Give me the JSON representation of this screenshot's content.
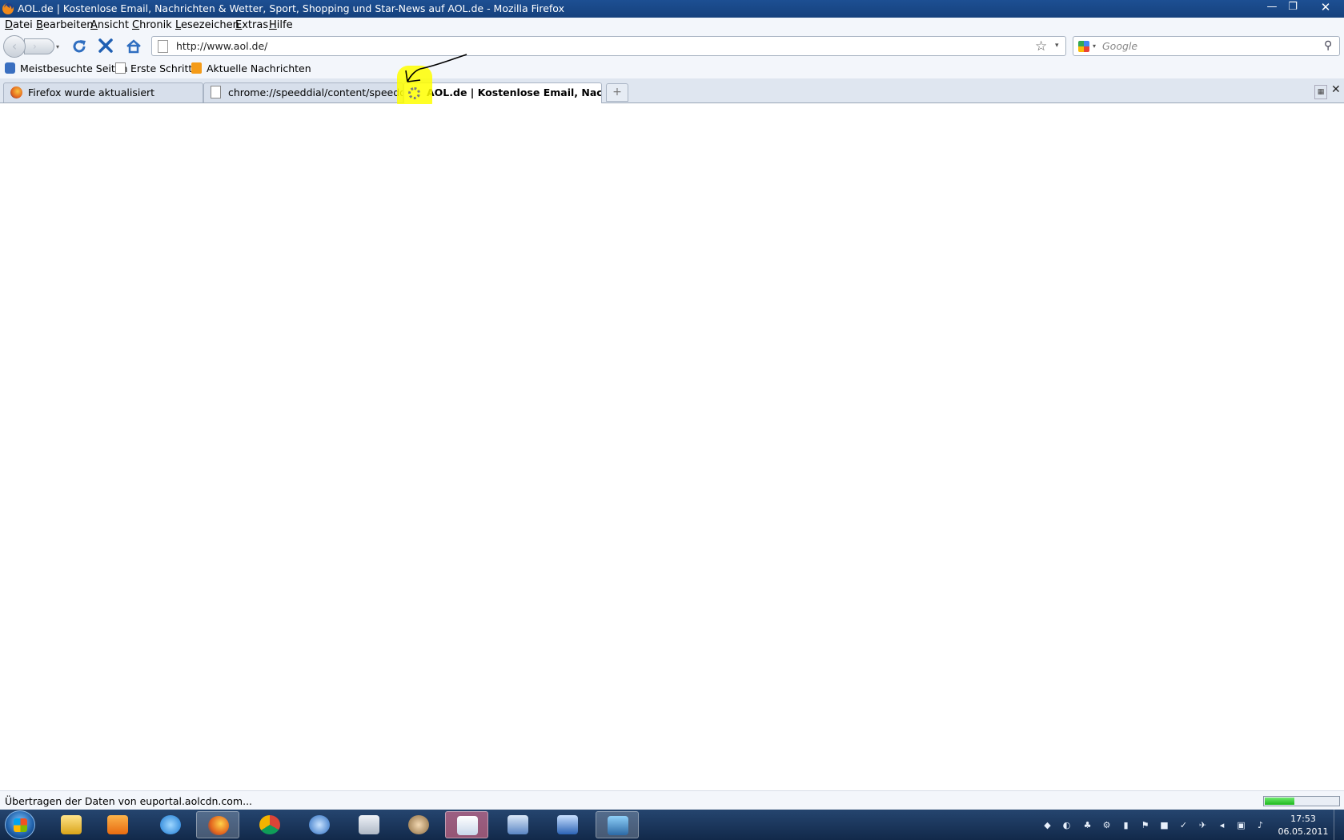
{
  "window": {
    "title": "AOL.de | Kostenlose Email, Nachrichten & Wetter, Sport, Shopping und Star-News auf AOL.de - Mozilla Firefox",
    "minimize_label": "—",
    "maximize_label": "❐",
    "close_label": "✕"
  },
  "menu": {
    "items": [
      {
        "mnemonic": "D",
        "rest": "atei"
      },
      {
        "mnemonic": "B",
        "rest": "earbeiten"
      },
      {
        "mnemonic": "A",
        "rest": "nsicht"
      },
      {
        "mnemonic": "C",
        "rest": "hronik"
      },
      {
        "mnemonic": "L",
        "rest": "esezeichen"
      },
      {
        "mnemonic": "E",
        "rest": "xtras"
      },
      {
        "mnemonic": "H",
        "rest": "ilfe"
      }
    ]
  },
  "nav": {
    "back_glyph": "‹",
    "forward_glyph": "›",
    "history_glyph": "▾",
    "url": "http://www.aol.de/",
    "star_glyph": "☆",
    "dropdown_glyph": "▾"
  },
  "search": {
    "placeholder": "Google",
    "engine_dropdown_glyph": "▾",
    "go_glyph": "⚲"
  },
  "bookmarks": {
    "items": [
      {
        "label": "Meistbesuchte Seiten",
        "icon": "most-visited-icon"
      },
      {
        "label": "Erste Schritte",
        "icon": "page-icon"
      },
      {
        "label": "Aktuelle Nachrichten",
        "icon": "rss-feed-icon"
      }
    ]
  },
  "tabs": {
    "items": [
      {
        "label": "Firefox wurde aktualisiert",
        "icon": "firefox-icon",
        "active": false
      },
      {
        "label": "chrome://speeddial/content/speeddial....",
        "icon": "page-icon",
        "active": false
      },
      {
        "label": "AOL.de | Kostenlose Email, Nachricht...",
        "icon": "loading-spinner-icon",
        "active": true
      }
    ],
    "new_tab_glyph": "+",
    "list_all_glyph": "▦",
    "close_glyph": "✕"
  },
  "status": {
    "text": "Übertragen der Daten von euportal.aolcdn.com...",
    "progress": 0.4
  },
  "taskbar": {
    "apps": [
      {
        "name": "windows-explorer",
        "icon": "folder-icon"
      },
      {
        "name": "media-player",
        "icon": "media-player-icon"
      },
      {
        "name": "internet-explorer",
        "icon": "ie-icon"
      },
      {
        "name": "firefox",
        "icon": "firefox-icon",
        "active": true
      },
      {
        "name": "chrome",
        "icon": "chrome-icon"
      },
      {
        "name": "thunderbird",
        "icon": "thunderbird-icon"
      },
      {
        "name": "calculator",
        "icon": "calculator-icon"
      },
      {
        "name": "tool",
        "icon": "tool-icon"
      },
      {
        "name": "snipping-tool",
        "icon": "scissors-icon",
        "active": true
      },
      {
        "name": "card",
        "icon": "card-icon"
      },
      {
        "name": "info",
        "icon": "info-icon"
      },
      {
        "name": "photo-viewer",
        "icon": "photo-icon"
      }
    ],
    "clock": {
      "time": "17:53",
      "date": "06.05.2011"
    }
  },
  "colors": {
    "titlebar": "#1d4f93",
    "highlight": "#ffff00",
    "progress_fill": "#1eb81e"
  }
}
